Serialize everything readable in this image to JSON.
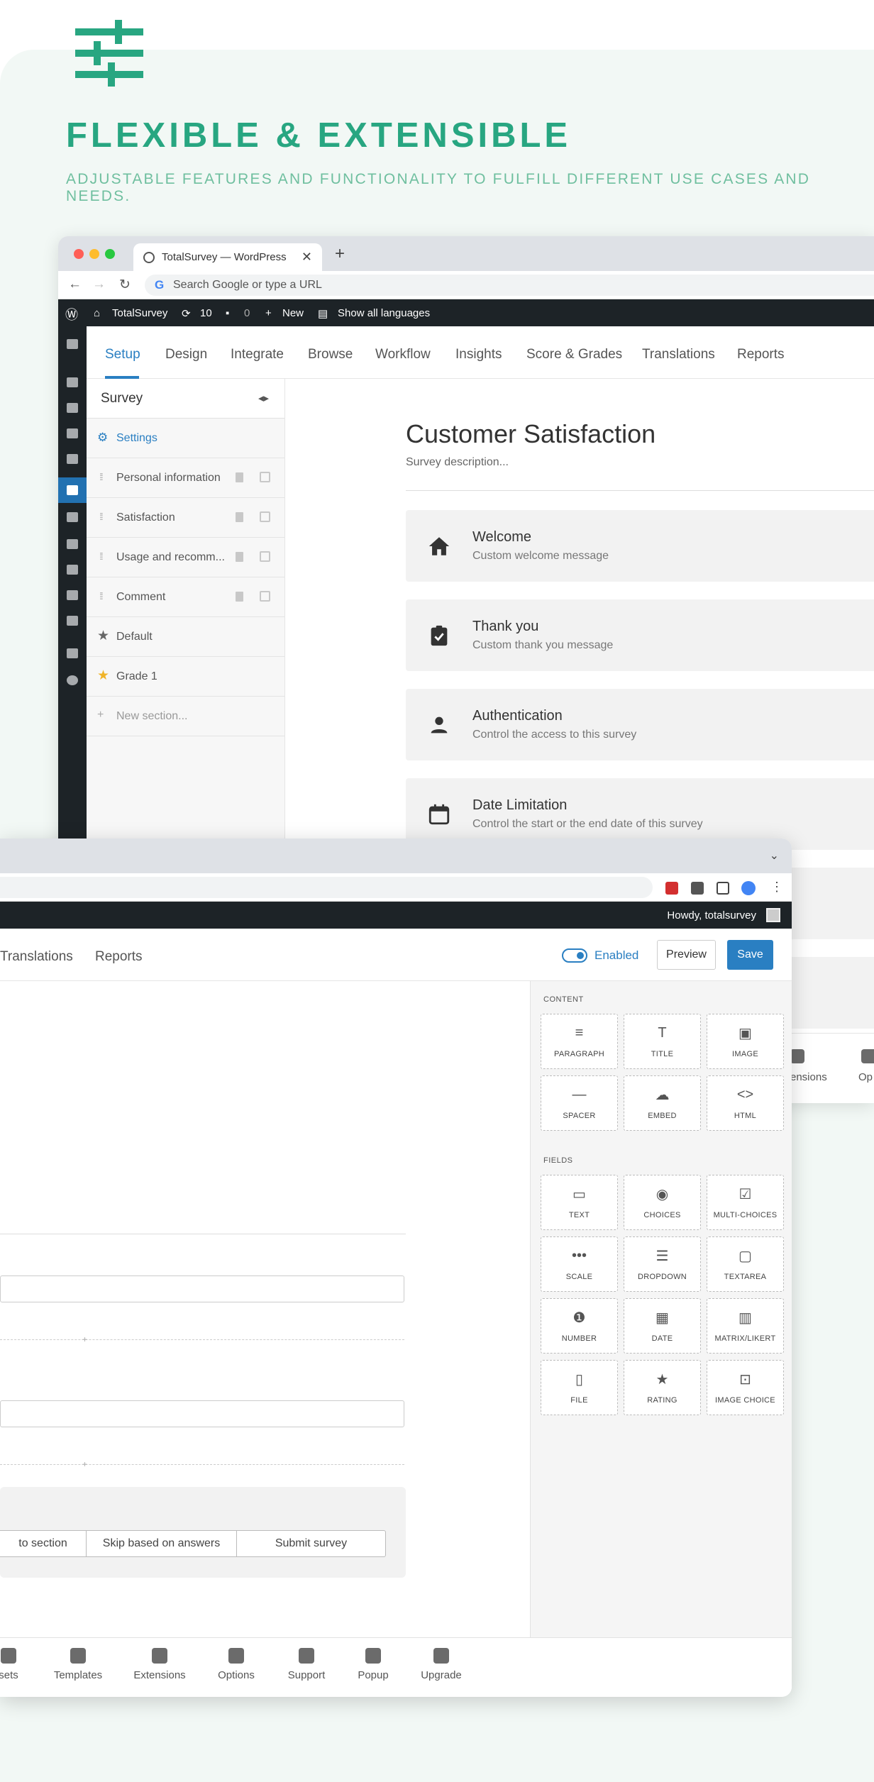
{
  "hero": {
    "headline": "FLEXIBLE & EXTENSIBLE",
    "subline": "ADJUSTABLE FEATURES AND FUNCTIONALITY TO FULFILL DIFFERENT USE CASES AND NEEDS.",
    "accent_color": "#28a681",
    "logo_icon": "sliders-icon"
  },
  "browser": {
    "tab_title": "TotalSurvey — WordPress",
    "new_tab": "+",
    "url_placeholder": "Search Google or type a URL"
  },
  "wp_admin_bar": {
    "site_name": "TotalSurvey",
    "updates": "10",
    "comments": "0",
    "new_label": "New",
    "languages": "Show all languages",
    "howdy": "Howdy, totalsurvey"
  },
  "top_tabs": [
    "Setup",
    "Design",
    "Integrate",
    "Browse",
    "Workflow",
    "Insights",
    "Score & Grades",
    "Translations",
    "Reports"
  ],
  "survey_panel": {
    "title": "Survey",
    "settings": "Settings",
    "sections": [
      "Personal information",
      "Satisfaction",
      "Usage and recomm...",
      "Comment"
    ],
    "grades": [
      "Default",
      "Grade 1"
    ],
    "new_section": "New section..."
  },
  "survey": {
    "title": "Customer Satisfaction",
    "description": "Survey description...",
    "cards": [
      {
        "title": "Welcome",
        "subtitle": "Custom welcome message",
        "icon": "home-icon"
      },
      {
        "title": "Thank you",
        "subtitle": "Custom thank you message",
        "icon": "clipboard-check-icon"
      },
      {
        "title": "Authentication",
        "subtitle": "Control the access to this survey",
        "icon": "person-icon"
      },
      {
        "title": "Date Limitation",
        "subtitle": "Control the start or the end date of this survey",
        "icon": "calendar-icon"
      }
    ]
  },
  "editor": {
    "tabs_visible": [
      "Translations",
      "Reports"
    ],
    "enabled_label": "Enabled",
    "preview_label": "Preview",
    "save_label": "Save",
    "actions": [
      "to section",
      "Skip based on answers",
      "Submit survey"
    ]
  },
  "elements": {
    "content_label": "CONTENT",
    "fields_label": "FIELDS",
    "content": [
      "PARAGRAPH",
      "TITLE",
      "IMAGE",
      "SPACER",
      "EMBED",
      "HTML"
    ],
    "fields": [
      "TEXT",
      "CHOICES",
      "MULTI-CHOICES",
      "SCALE",
      "DROPDOWN",
      "TEXTAREA",
      "NUMBER",
      "DATE",
      "MATRIX/LIKERT",
      "FILE",
      "RATING",
      "IMAGE CHOICE"
    ]
  },
  "bottom_bar": [
    "sets",
    "Templates",
    "Extensions",
    "Options",
    "Support",
    "Popup",
    "Upgrade"
  ],
  "bottom_bar_peek": [
    "ensions",
    "Op"
  ],
  "colors": {
    "primary": "#2a7fc2",
    "admin_bar": "#1d2327",
    "star": "#f0b429"
  }
}
